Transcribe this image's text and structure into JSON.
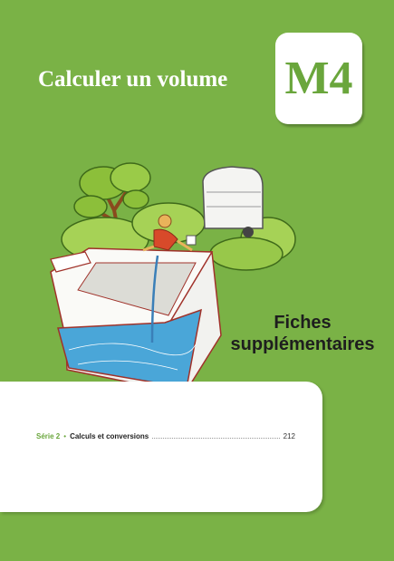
{
  "header": {
    "title": "Calculer un volume",
    "module_code": "M4"
  },
  "illustration": {
    "icon": "water-tank-illustration-icon"
  },
  "section_heading": {
    "line1": "Fiches",
    "line2": "supplémentaires"
  },
  "contents": {
    "entries": [
      {
        "serie": "Série 2",
        "bullet": "•",
        "name": "Calculs et conversions",
        "page": "212"
      }
    ]
  },
  "colors": {
    "background": "#7ab246",
    "accent": "#6aa63c",
    "water": "#4aa6d8"
  }
}
